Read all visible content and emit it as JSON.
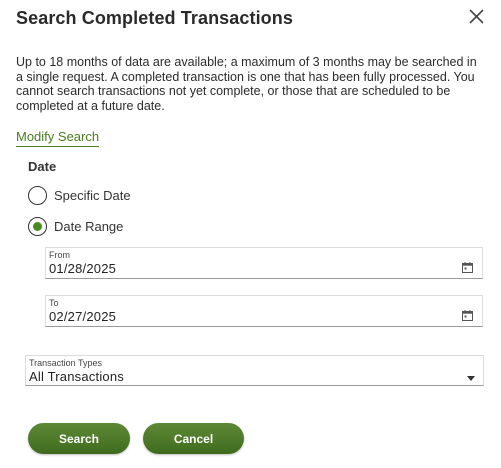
{
  "dialog": {
    "title": "Search Completed Transactions",
    "description": "Up to 18 months of data are available; a maximum of 3 months may be searched in a single request. A completed transaction is one that has been fully processed. You cannot search transactions not yet complete, or those that are scheduled to be completed at a future date.",
    "modify_link": "Modify Search"
  },
  "date_section": {
    "heading": "Date",
    "options": [
      {
        "label": "Specific Date",
        "selected": false
      },
      {
        "label": "Date Range",
        "selected": true
      }
    ],
    "from": {
      "label": "From",
      "value": "01/28/2025",
      "icon": "calendar-icon"
    },
    "to": {
      "label": "To",
      "value": "02/27/2025",
      "icon": "calendar-icon"
    }
  },
  "transaction_types": {
    "label": "Transaction Types",
    "value": "All Transactions",
    "icon": "caret-down-icon"
  },
  "buttons": {
    "search": "Search",
    "cancel": "Cancel"
  },
  "colors": {
    "accent": "#4a7c1f",
    "button_top": "#5e8a36",
    "button_bottom": "#3f6a1d"
  }
}
